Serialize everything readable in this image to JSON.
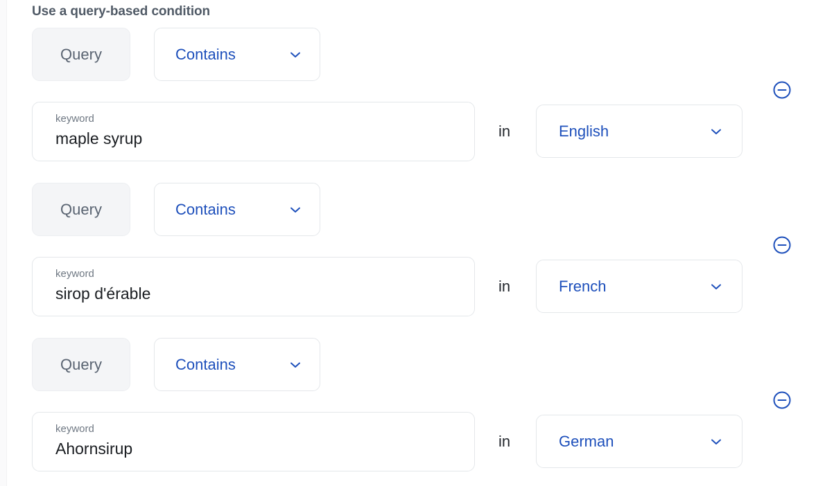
{
  "section": {
    "title": "Use a query-based condition"
  },
  "labels": {
    "in": "in",
    "keyword_label": "keyword"
  },
  "colors": {
    "accent_blue": "#1d4fbb",
    "chip_bg": "#f4f5f7",
    "border": "#e4e7ea",
    "title_text": "#505a66",
    "value_text": "#1a1d21",
    "muted_text": "#6f7883"
  },
  "icons": {
    "chevron_down": "chevron-down-icon",
    "remove": "minus-circle-icon"
  },
  "conditions": [
    {
      "field_label": "Query",
      "operator": "Contains",
      "keyword_label": "keyword",
      "keyword_value": "maple syrup",
      "keyword_placeholder": "keyword",
      "in_label": "in",
      "language": "English",
      "remove_label": "Remove condition"
    },
    {
      "field_label": "Query",
      "operator": "Contains",
      "keyword_label": "keyword",
      "keyword_value": "sirop d'érable",
      "keyword_placeholder": "keyword",
      "in_label": "in",
      "language": "French",
      "remove_label": "Remove condition"
    },
    {
      "field_label": "Query",
      "operator": "Contains",
      "keyword_label": "keyword",
      "keyword_value": "Ahornsirup",
      "keyword_placeholder": "keyword",
      "in_label": "in",
      "language": "German",
      "remove_label": "Remove condition"
    }
  ]
}
